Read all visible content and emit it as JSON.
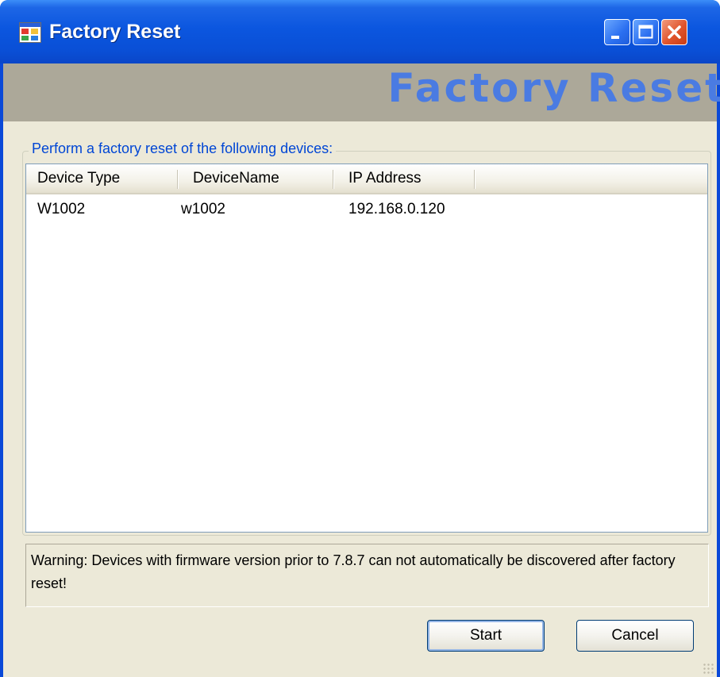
{
  "window": {
    "title": "Factory Reset",
    "banner_title": "Factory Reset"
  },
  "group": {
    "label": "Perform a factory reset of the following devices:"
  },
  "table": {
    "columns": [
      "Device Type",
      "DeviceName",
      "IP Address"
    ],
    "rows": [
      [
        "W1002",
        "w1002",
        "192.168.0.120"
      ]
    ]
  },
  "warning": {
    "text": "Warning: Devices with firmware version prior to 7.8.7 can not automatically be discovered after factory reset!"
  },
  "buttons": {
    "start": "Start",
    "cancel": "Cancel"
  },
  "colors": {
    "titlebar": "#0a49d8",
    "banner_bg": "#aca899",
    "banner_text": "#4a7be2",
    "group_label": "#0046d5",
    "client_bg": "#ece9d8"
  },
  "icons": {
    "app": "app-window-icon",
    "minimize": "minimize-icon",
    "maximize": "maximize-icon",
    "close": "close-icon"
  }
}
